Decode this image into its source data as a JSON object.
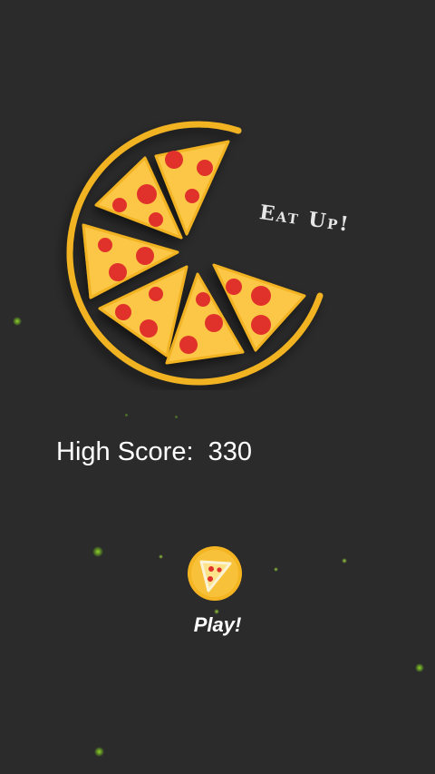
{
  "app": {
    "tagline": "Eat Up!",
    "high_score_label": "High Score:",
    "high_score_value": "330",
    "play_label": "Play!"
  },
  "colors": {
    "background": "#2b2b2b",
    "crust": "#f2b320",
    "cheese": "#fcc646",
    "pepperoni": "#e0322a",
    "sparkle": "#7ac421"
  },
  "icons": {
    "logo": "pizza-logo-icon",
    "play": "pizza-slice-icon"
  }
}
